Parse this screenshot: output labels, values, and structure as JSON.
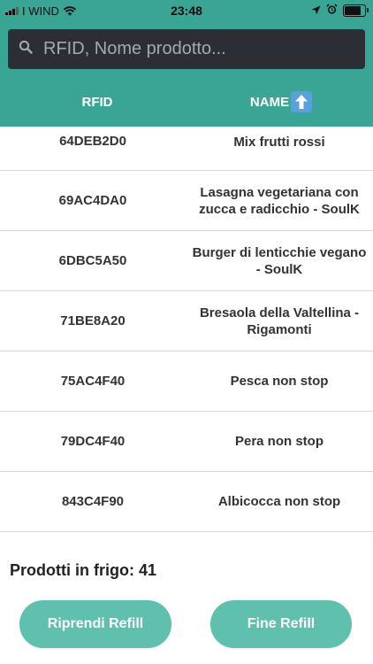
{
  "status_bar": {
    "carrier": "I WIND",
    "time": "23:48",
    "icons": [
      "signal-icon",
      "wifi-icon",
      "location-arrow-icon",
      "alarm-icon",
      "battery-icon"
    ],
    "battery_level": 0.8
  },
  "colors": {
    "header_bg": "#3aa594",
    "search_bg": "#2b2f35",
    "button_bg": "#5ec0ad",
    "sort_icon_bg": "#5aa0dd"
  },
  "search": {
    "placeholder": "RFID, Nome prodotto...",
    "value": ""
  },
  "table": {
    "headers": {
      "rfid": "RFID",
      "name": "NAME",
      "sort_icon": "arrow-up-icon"
    },
    "rows": [
      {
        "rfid": "64DEB2D0",
        "name": "Mix frutti rossi"
      },
      {
        "rfid": "69AC4DA0",
        "name": "Lasagna vegetariana con zucca e radicchio - SoulK"
      },
      {
        "rfid": "6DBC5A50",
        "name": "Burger di lenticchie vegano - SoulK"
      },
      {
        "rfid": "71BE8A20",
        "name": "Bresaola della Valtellina - Rigamonti"
      },
      {
        "rfid": "75AC4F40",
        "name": "Pesca non stop"
      },
      {
        "rfid": "79DC4F40",
        "name": "Pera non stop"
      },
      {
        "rfid": "843C4F90",
        "name": "Albicocca non stop"
      }
    ]
  },
  "footer": {
    "count_label": "Prodotti in frigo: 41",
    "resume_button": "Riprendi Refill",
    "end_button": "Fine Refill"
  }
}
